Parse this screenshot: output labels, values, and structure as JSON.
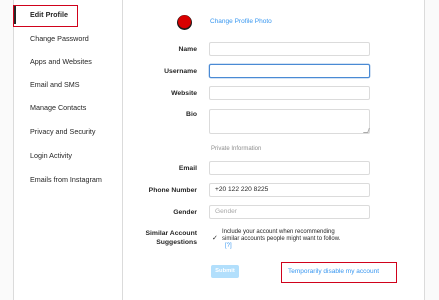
{
  "sidebar": {
    "items": [
      {
        "label": "Edit Profile"
      },
      {
        "label": "Change Password"
      },
      {
        "label": "Apps and Websites"
      },
      {
        "label": "Email and SMS"
      },
      {
        "label": "Manage Contacts"
      },
      {
        "label": "Privacy and Security"
      },
      {
        "label": "Login Activity"
      },
      {
        "label": "Emails from Instagram"
      }
    ],
    "active": "Edit Profile"
  },
  "profile": {
    "change_photo": "Change Profile Photo"
  },
  "form": {
    "name": {
      "label": "Name",
      "value": ""
    },
    "username": {
      "label": "Username",
      "value": ""
    },
    "website": {
      "label": "Website",
      "value": ""
    },
    "bio": {
      "label": "Bio",
      "value": ""
    },
    "private_section": "Private Information",
    "email": {
      "label": "Email",
      "value": ""
    },
    "phone": {
      "label": "Phone Number",
      "value": "+20 122 220 8225"
    },
    "gender": {
      "label": "Gender",
      "placeholder": "Gender"
    },
    "similar": {
      "label_line1": "Similar Account",
      "label_line2": "Suggestions",
      "text": "Include your account when recommending similar accounts people might want to follow.",
      "help": "[?]"
    },
    "submit": "Submit",
    "disable_link": "Temporarily disable my account"
  },
  "colors": {
    "accent": "#3897f0",
    "highlight": "#d0021b",
    "submit_disabled": "#b2dffc"
  }
}
